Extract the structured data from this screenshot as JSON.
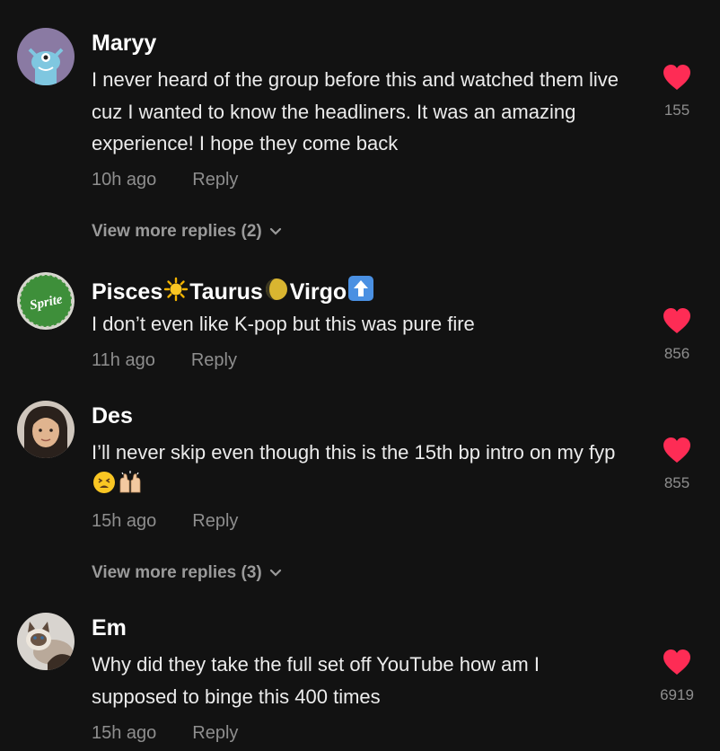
{
  "comments": [
    {
      "username": "Maryy",
      "text": "I never heard of the group before this and watched them live cuz I wanted to know the headliners. It was an amazing experience! I hope they come back",
      "time": "10h ago",
      "reply_label": "Reply",
      "likes": "155",
      "more_replies": "View more replies (2)"
    },
    {
      "username_parts": [
        "Pisces",
        "Taurus",
        "Virgo"
      ],
      "text": "I don’t even like K-pop but this was pure fire",
      "time": "11h ago",
      "reply_label": "Reply",
      "likes": "856",
      "avatar_text": "Sprite"
    },
    {
      "username": "Des",
      "text": "I’ll never skip even though this is the 15th bp intro on my fyp",
      "time": "15h ago",
      "reply_label": "Reply",
      "likes": "855",
      "more_replies": "View more replies (3)"
    },
    {
      "username": "Em",
      "text": "Why did they take the full set off YouTube how am I supposed to binge this 400 times",
      "time": "15h ago",
      "reply_label": "Reply",
      "likes": "6919"
    }
  ],
  "colors": {
    "background": "#121212",
    "heart": "#fe2c55",
    "secondary_text": "#8e8e8e"
  }
}
